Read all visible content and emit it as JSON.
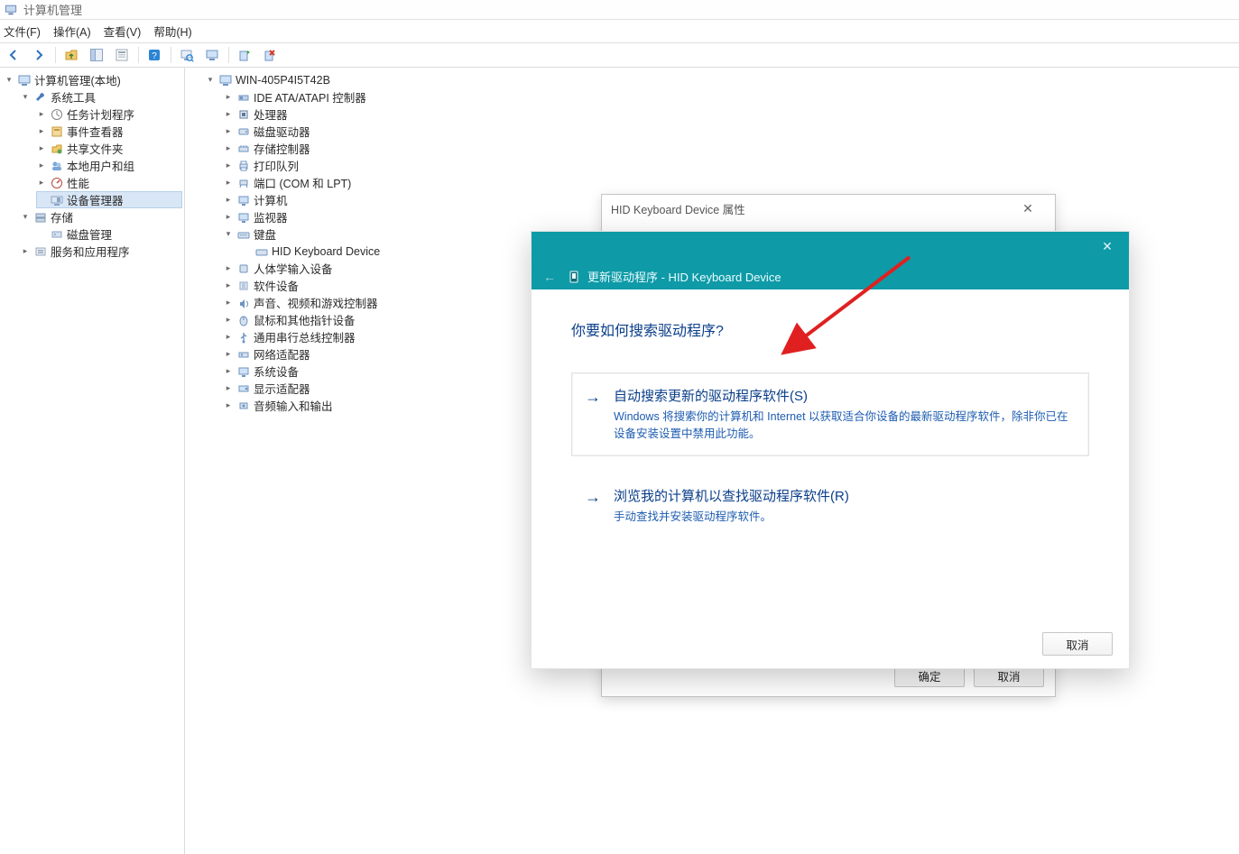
{
  "app": {
    "title": "计算机管理"
  },
  "menus": {
    "file": "文件(F)",
    "action": "操作(A)",
    "view": "查看(V)",
    "help": "帮助(H)"
  },
  "left_tree": {
    "root": "计算机管理(本地)",
    "sys_tools": "系统工具",
    "task_sched": "任务计划程序",
    "event_viewer": "事件查看器",
    "shared": "共享文件夹",
    "local_users": "本地用户和组",
    "perf": "性能",
    "dev_mgr": "设备管理器",
    "storage": "存储",
    "disk_mgmt": "磁盘管理",
    "services": "服务和应用程序"
  },
  "device_tree": {
    "root": "WIN-405P4I5T42B",
    "ide": "IDE ATA/ATAPI 控制器",
    "cpu": "处理器",
    "disk": "磁盘驱动器",
    "storage_ctrl": "存储控制器",
    "print": "打印队列",
    "ports": "端口 (COM 和 LPT)",
    "computer": "计算机",
    "monitor": "监视器",
    "keyboard": "键盘",
    "hid_kbd": "HID Keyboard Device",
    "hid": "人体学输入设备",
    "software": "软件设备",
    "sound": "声音、视频和游戏控制器",
    "mouse": "鼠标和其他指针设备",
    "usb": "通用串行总线控制器",
    "network": "网络适配器",
    "system": "系统设备",
    "display": "显示适配器",
    "audio": "音频输入和输出"
  },
  "props_dialog": {
    "title": "HID Keyboard Device 属性",
    "ok": "确定",
    "cancel": "取消"
  },
  "wizard": {
    "title": "更新驱动程序 - HID Keyboard Device",
    "heading": "你要如何搜索驱动程序?",
    "opt1_title": "自动搜索更新的驱动程序软件(S)",
    "opt1_desc": "Windows 将搜索你的计算机和 Internet 以获取适合你设备的最新驱动程序软件，除非你已在设备安装设置中禁用此功能。",
    "opt2_title": "浏览我的计算机以查找驱动程序软件(R)",
    "opt2_desc": "手动查找并安装驱动程序软件。",
    "cancel": "取消"
  }
}
